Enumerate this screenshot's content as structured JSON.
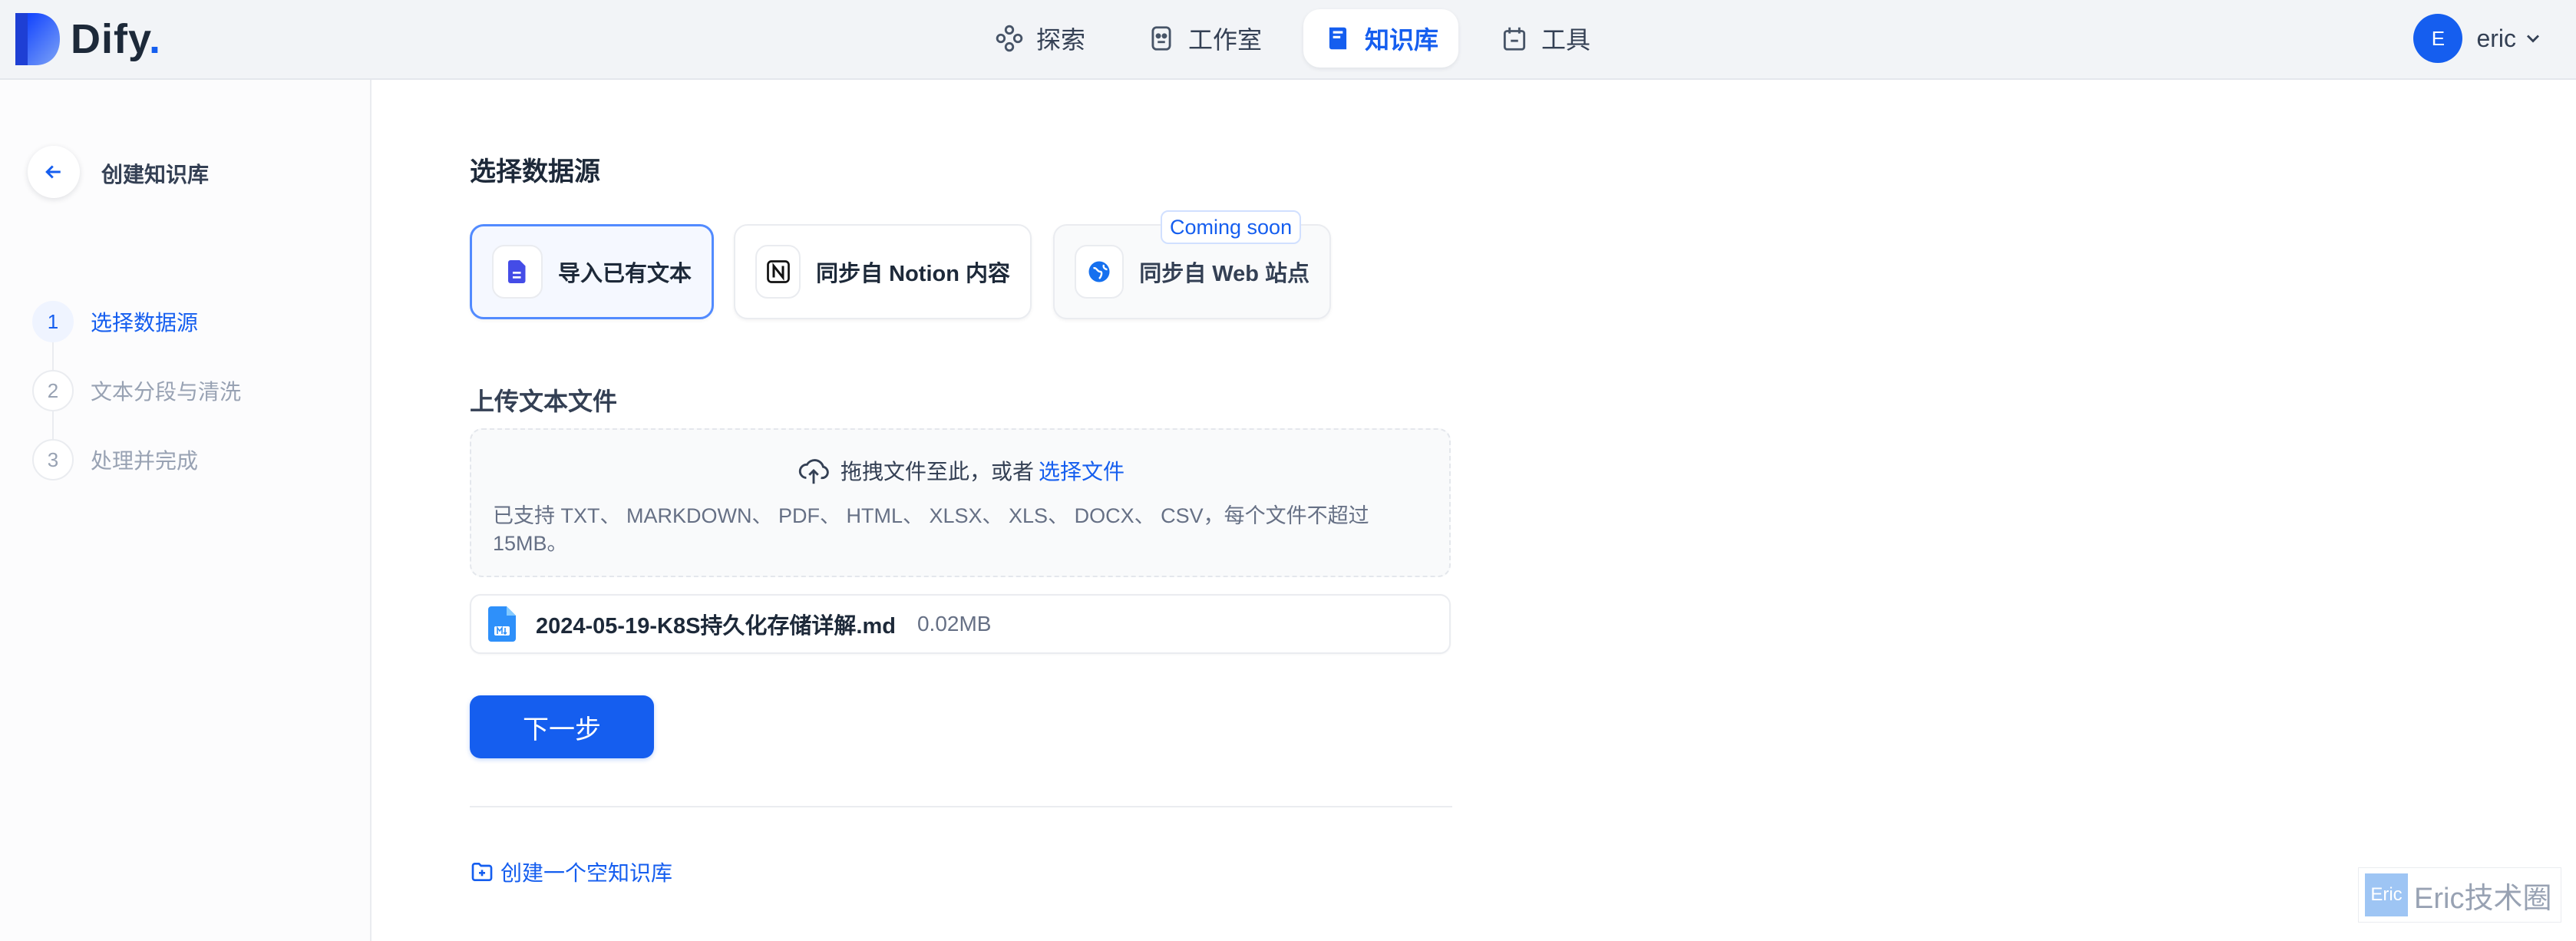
{
  "app": {
    "logo_text": "Dify",
    "logo_dot": "."
  },
  "nav": {
    "items": [
      {
        "label": "探索",
        "icon": "explore-icon"
      },
      {
        "label": "工作室",
        "icon": "robot-icon"
      },
      {
        "label": "知识库",
        "icon": "book-icon",
        "active": true
      },
      {
        "label": "工具",
        "icon": "tools-icon"
      }
    ]
  },
  "user": {
    "initial": "E",
    "name": "eric"
  },
  "sidebar": {
    "title": "创建知识库",
    "steps": [
      {
        "number": "1",
        "label": "选择数据源",
        "active": true
      },
      {
        "number": "2",
        "label": "文本分段与清洗"
      },
      {
        "number": "3",
        "label": "处理并完成"
      }
    ]
  },
  "main": {
    "section_title": "选择数据源",
    "sources": [
      {
        "label": "导入已有文本",
        "icon": "document-icon",
        "selected": true
      },
      {
        "label": "同步自 Notion 内容",
        "icon": "notion-icon"
      },
      {
        "label": "同步自 Web 站点",
        "icon": "web-icon",
        "badge": "Coming soon"
      }
    ],
    "upload_title": "上传文本文件",
    "dropzone": {
      "prompt": "拖拽文件至此，或者",
      "link": "选择文件",
      "hint": "已支持 TXT、 MARKDOWN、 PDF、 HTML、 XLSX、 XLS、 DOCX、 CSV，每个文件不超过 15MB。"
    },
    "file": {
      "name": "2024-05-19-K8S持久化存储详解.md",
      "size": "0.02MB"
    },
    "next_button": "下一步",
    "empty_link": "创建一个空知识库"
  },
  "watermark": {
    "badge": "Eric",
    "text": "Eric技术圈"
  },
  "colors": {
    "accent": "#155eef",
    "text": "#1d2939",
    "muted": "#98a2b3",
    "border": "#eaecf0"
  }
}
